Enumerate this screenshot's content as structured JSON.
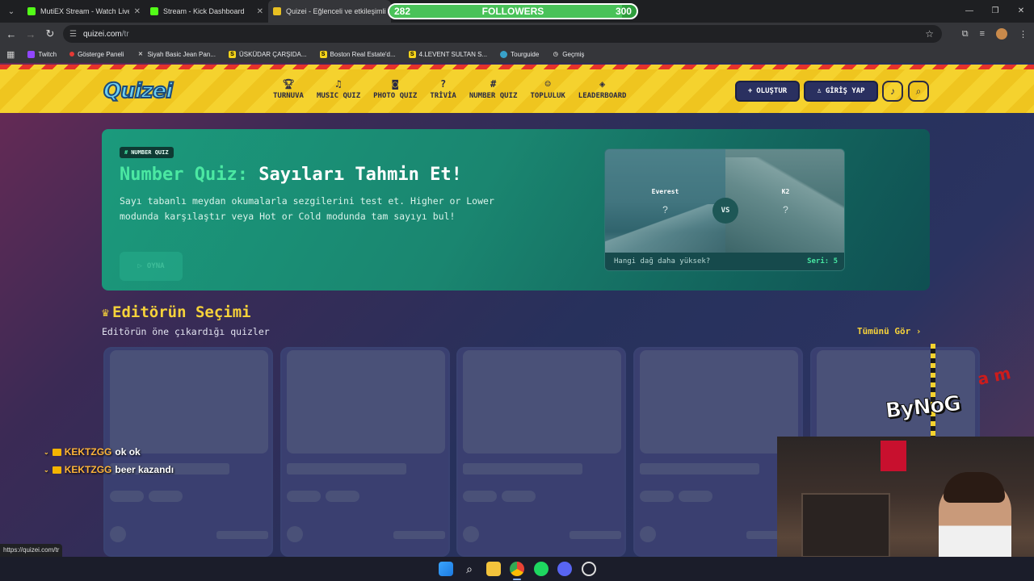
{
  "browser": {
    "tabs": [
      {
        "title": "MutiEX Stream - Watch Live on",
        "favicon": "kick-icon",
        "active": false
      },
      {
        "title": "Stream - Kick Dashboard",
        "favicon": "kick-icon",
        "active": false
      },
      {
        "title": "Quizei - Eğlenceli ve etkileşimli",
        "favicon": "quizei-icon",
        "active": true
      }
    ],
    "url_host": "quizei.com",
    "url_path": "/tr",
    "bookmarks": [
      {
        "label": "Twitch",
        "icon": "twitch-icon"
      },
      {
        "label": "Gösterge Paneli",
        "icon": "dashboard-icon"
      },
      {
        "label": "Siyah Basic Jean Pan...",
        "icon": "x-icon"
      },
      {
        "label": "ÜSKÜDAR ÇARŞIDA...",
        "icon": "s-icon"
      },
      {
        "label": "Boston Real Estate'd...",
        "icon": "s-icon"
      },
      {
        "label": "4.LEVENT SULTAN S...",
        "icon": "s-icon"
      },
      {
        "label": "Tourguide",
        "icon": "tourguide-icon"
      },
      {
        "label": "Geçmiş",
        "icon": "history-icon"
      }
    ],
    "status_url": "https://quizei.com/tr"
  },
  "followers_widget": {
    "current": "282",
    "label": "FOLLOWERS",
    "goal": "300",
    "progress": 0.94
  },
  "header": {
    "logo": "Quizei",
    "nav": [
      {
        "label": "TURNUVA",
        "icon": "trophy-icon"
      },
      {
        "label": "MUSIC QUIZ",
        "icon": "music-note-icon"
      },
      {
        "label": "PHOTO QUIZ",
        "icon": "camera-icon"
      },
      {
        "label": "TRİVİA",
        "icon": "question-bubble-icon"
      },
      {
        "label": "NUMBER QUIZ",
        "icon": "hash-icon"
      },
      {
        "label": "TOPLULUK",
        "icon": "users-icon"
      },
      {
        "label": "LEADERBOARD",
        "icon": "medal-icon"
      }
    ],
    "create_label": "OLUŞTUR",
    "login_label": "GİRİŞ YAP"
  },
  "hero": {
    "badge": "NUMBER QUIZ",
    "title_accent": "Number Quiz:",
    "title_rest": "Sayıları Tahmin Et!",
    "description": "Sayı tabanlı meydan okumalarla sezgilerini test et. Higher or Lower modunda karşılaştır veya Hot or Cold modunda tam sayıyı bul!",
    "play_label": "OYNA",
    "preview": {
      "left_name": "Everest",
      "right_name": "K2",
      "unknown": "?",
      "vs": "VS",
      "question": "Hangi dağ daha yüksek?",
      "score": "Seri: 5"
    }
  },
  "editors_pick": {
    "title": "Editörün Seçimi",
    "subtitle": "Editörün öne çıkardığı quizler",
    "see_all": "Tümünü Gör"
  },
  "chat": [
    {
      "user": "KEKTZGG",
      "message": "ok ok"
    },
    {
      "user": "KEKTZGG",
      "message": "beer kazandı"
    }
  ],
  "overlay_brand": "ByNoG",
  "overlay_brand_mark": "a m"
}
